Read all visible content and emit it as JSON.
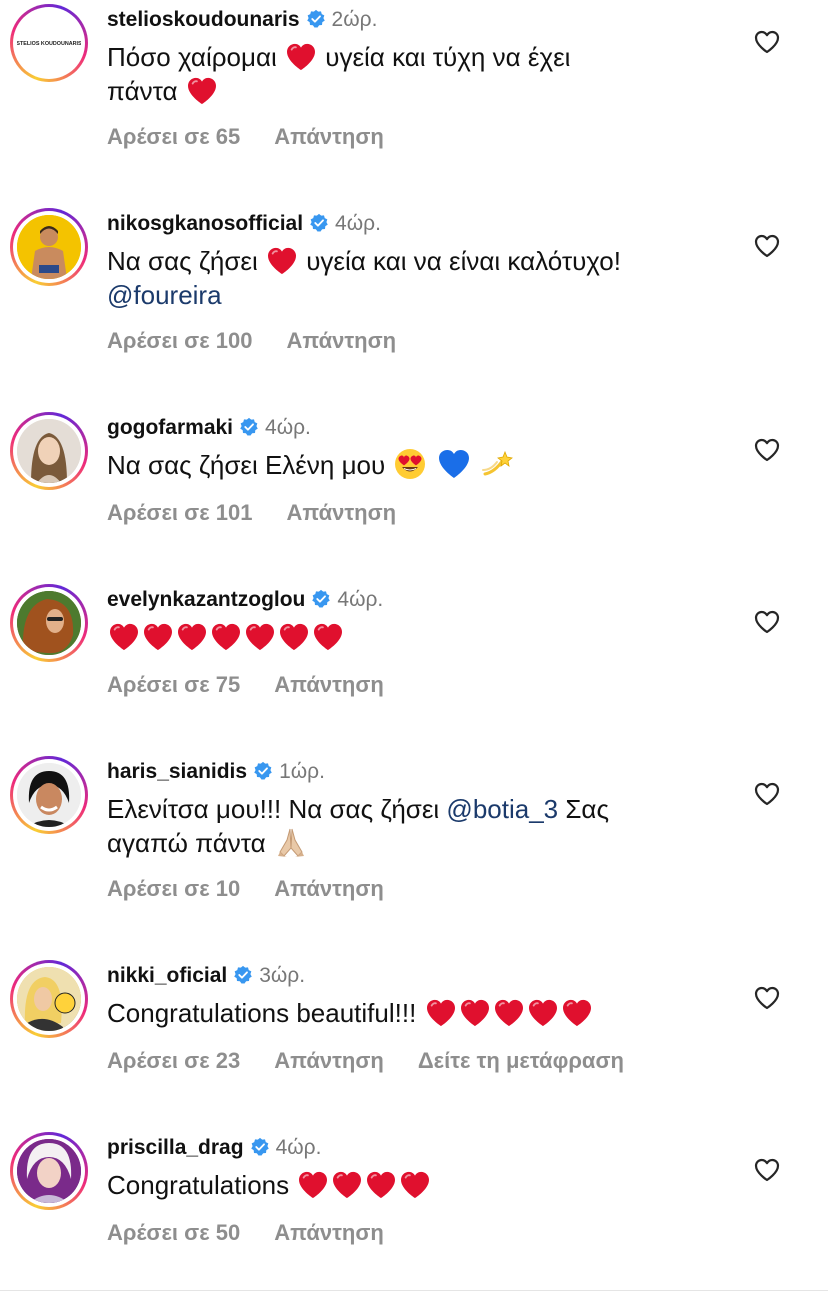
{
  "comments": [
    {
      "username": "stelioskoudounaris",
      "time": "2ώρ.",
      "avatar_text": "STELIOS KOUDOUNARIS",
      "segments": [
        {
          "t": "text",
          "v": "Πόσο χαίρομαι "
        },
        {
          "t": "heart"
        },
        {
          "t": "text",
          "v": " υγεία και τύχη να έχει"
        },
        {
          "t": "br"
        },
        {
          "t": "text",
          "v": "πάντα "
        },
        {
          "t": "heart"
        }
      ],
      "likes": "Αρέσει σε 65",
      "reply": "Απάντηση"
    },
    {
      "username": "nikosgkanosofficial",
      "time": "4ώρ.",
      "segments": [
        {
          "t": "text",
          "v": "Να σας ζήσει "
        },
        {
          "t": "heart"
        },
        {
          "t": "text",
          "v": " υγεία και να είναι καλότυχο!"
        },
        {
          "t": "br"
        },
        {
          "t": "mention",
          "v": "@foureira"
        }
      ],
      "likes": "Αρέσει σε 100",
      "reply": "Απάντηση"
    },
    {
      "username": "gogofarmaki",
      "time": "4ώρ.",
      "segments": [
        {
          "t": "text",
          "v": "Να σας ζήσει Ελένη μου "
        },
        {
          "t": "heart-eyes"
        },
        {
          "t": "text",
          "v": " "
        },
        {
          "t": "blue-heart"
        },
        {
          "t": "text",
          "v": " "
        },
        {
          "t": "dizzy"
        }
      ],
      "likes": "Αρέσει σε 101",
      "reply": "Απάντηση"
    },
    {
      "username": "evelynkazantzoglou",
      "time": "4ώρ.",
      "segments": [
        {
          "t": "heart"
        },
        {
          "t": "heart"
        },
        {
          "t": "heart"
        },
        {
          "t": "heart"
        },
        {
          "t": "heart"
        },
        {
          "t": "heart"
        },
        {
          "t": "heart"
        }
      ],
      "likes": "Αρέσει σε 75",
      "reply": "Απάντηση"
    },
    {
      "username": "haris_sianidis",
      "time": "1ώρ.",
      "segments": [
        {
          "t": "text",
          "v": "Ελενίτσα μου!!! Να σας ζήσει "
        },
        {
          "t": "mention",
          "v": "@botia_3"
        },
        {
          "t": "text",
          "v": " Σας"
        },
        {
          "t": "br"
        },
        {
          "t": "text",
          "v": "αγαπώ πάντα "
        },
        {
          "t": "pray"
        }
      ],
      "likes": "Αρέσει σε 10",
      "reply": "Απάντηση"
    },
    {
      "username": "nikki_oficial",
      "time": "3ώρ.",
      "segments": [
        {
          "t": "text",
          "v": "Congratulations beautiful!!! "
        },
        {
          "t": "heart"
        },
        {
          "t": "heart"
        },
        {
          "t": "heart"
        },
        {
          "t": "heart"
        },
        {
          "t": "heart"
        }
      ],
      "likes": "Αρέσει σε 23",
      "reply": "Απάντηση",
      "translate": "Δείτε τη μετάφραση"
    },
    {
      "username": "priscilla_drag",
      "time": "4ώρ.",
      "segments": [
        {
          "t": "text",
          "v": "Congratulations "
        },
        {
          "t": "heart"
        },
        {
          "t": "heart"
        },
        {
          "t": "heart"
        },
        {
          "t": "heart"
        }
      ],
      "likes": "Αρέσει σε 50",
      "reply": "Απάντηση"
    }
  ],
  "colors": {
    "heart": "#e0102e",
    "mention": "#1b3a6b",
    "muted": "#8e8e8e",
    "verified": "#3897f0"
  },
  "icons": {
    "like": "heart-outline-icon",
    "verified": "verified-badge-icon"
  }
}
